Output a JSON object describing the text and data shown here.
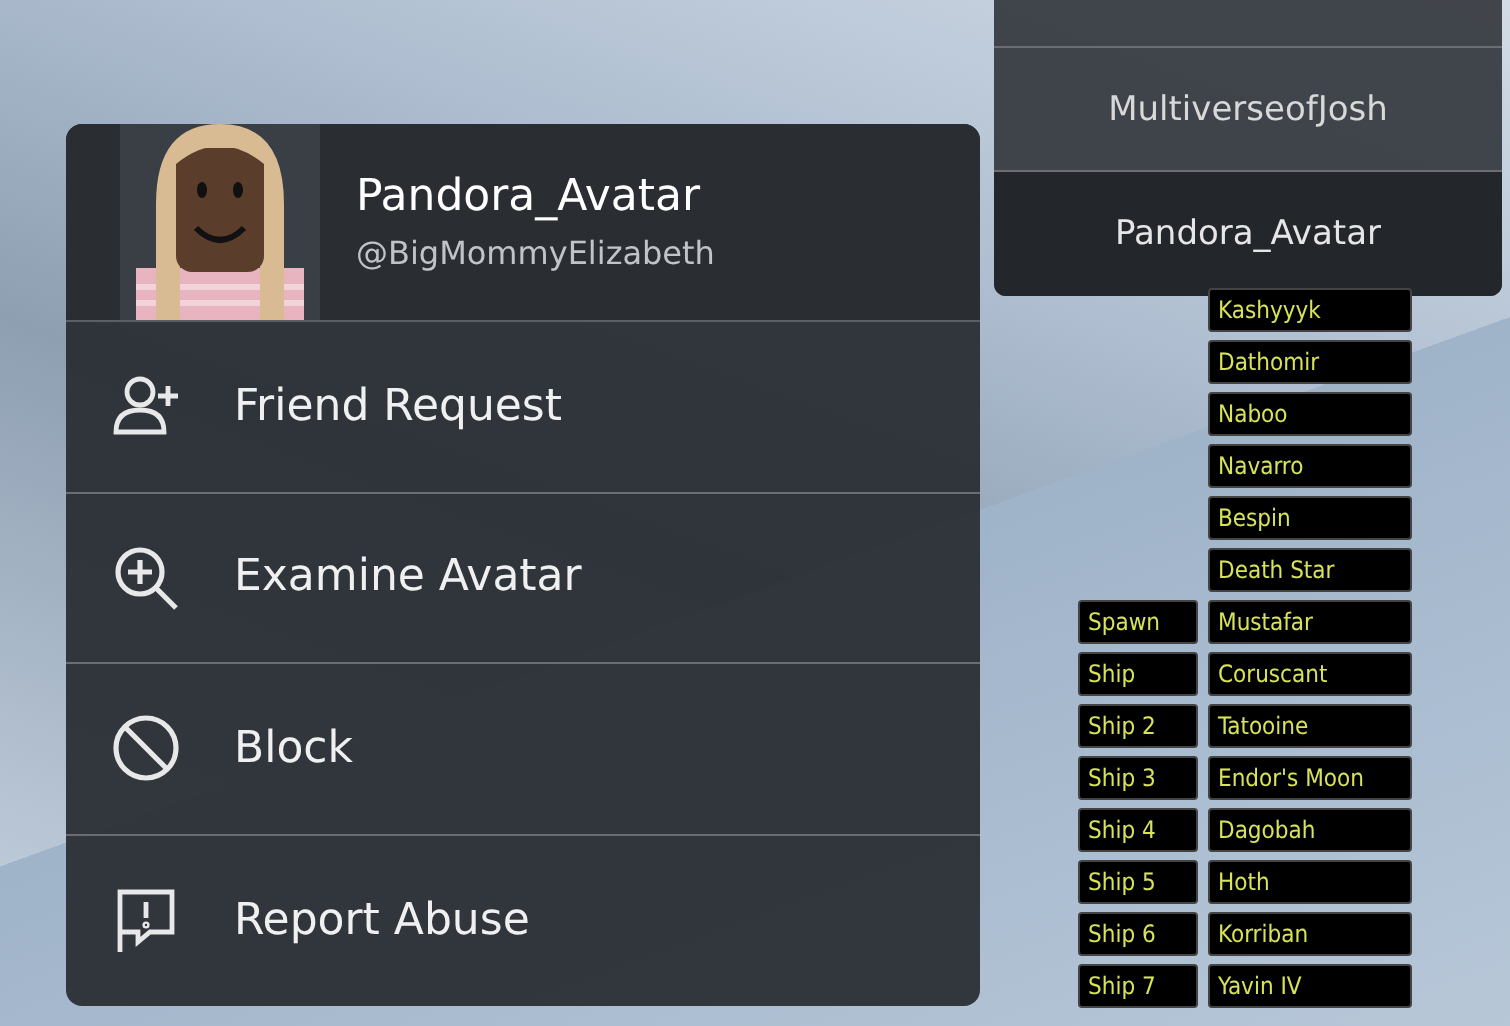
{
  "player_menu": {
    "display_name": "Pandora_Avatar",
    "username": "@BigMommyElizabeth",
    "actions": [
      {
        "kind": "friend",
        "label": "Friend Request"
      },
      {
        "kind": "examine",
        "label": "Examine Avatar"
      },
      {
        "kind": "block",
        "label": "Block"
      },
      {
        "kind": "report",
        "label": "Report Abuse"
      }
    ]
  },
  "player_list": [
    {
      "name": "MultiverseofJosh",
      "selected": false
    },
    {
      "name": "Pandora_Avatar",
      "selected": true
    }
  ],
  "planet_buttons": [
    "Kashyyyk",
    "Dathomir",
    "Naboo",
    "Navarro",
    "Bespin",
    "Death Star",
    "Mustafar",
    "Coruscant",
    "Tatooine",
    "Endor's Moon",
    "Dagobah",
    "Hoth",
    "Korriban",
    "Yavin IV"
  ],
  "ship_buttons": [
    "Spawn",
    "Ship",
    "Ship 2",
    "Ship 3",
    "Ship 4",
    "Ship 5",
    "Ship 6",
    "Ship 7"
  ]
}
